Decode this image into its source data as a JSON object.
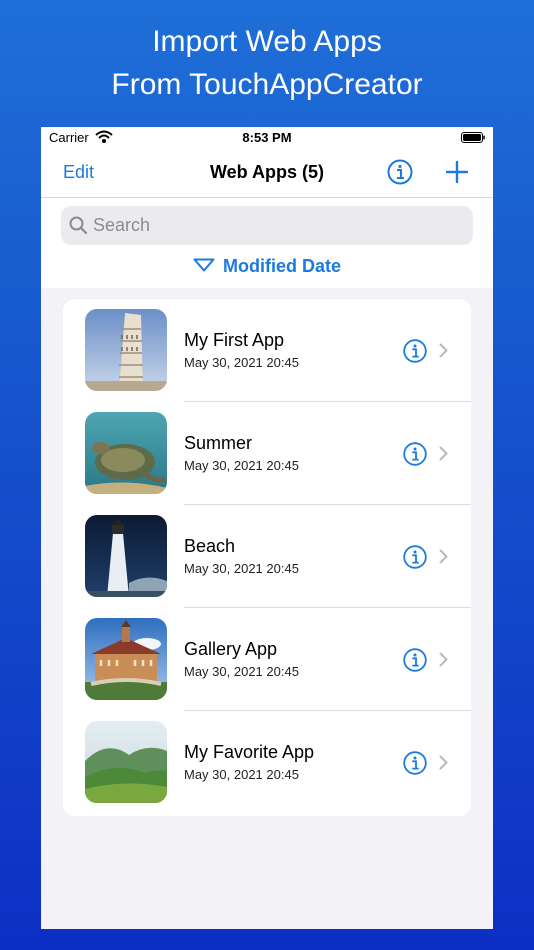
{
  "promo": {
    "line1": "Import Web Apps",
    "line2": "From TouchAppCreator"
  },
  "status_bar": {
    "carrier": "Carrier",
    "time": "8:53 PM",
    "icons": [
      "wifi-icon",
      "battery-icon"
    ]
  },
  "nav": {
    "edit_label": "Edit",
    "title": "Web Apps (5)",
    "icons": [
      "info-icon",
      "plus-icon"
    ]
  },
  "search": {
    "placeholder": "Search",
    "icon": "magnifier-icon"
  },
  "sort": {
    "label": "Modified Date",
    "icon": "triangle-down-icon"
  },
  "apps": [
    {
      "title": "My First App",
      "date": "May 30, 2021 20:45",
      "thumbnail": "leaning-tower-photo"
    },
    {
      "title": "Summer",
      "date": "May 30, 2021 20:45",
      "thumbnail": "sea-turtle-photo"
    },
    {
      "title": "Beach",
      "date": "May 30, 2021 20:45",
      "thumbnail": "lighthouse-photo"
    },
    {
      "title": "Gallery App",
      "date": "May 30, 2021 20:45",
      "thumbnail": "old-town-hall-photo"
    },
    {
      "title": "My Favorite App",
      "date": "May 30, 2021 20:45",
      "thumbnail": "green-hills-photo"
    }
  ],
  "colors": {
    "accent": "#1a7ae0",
    "background_top": "#1f6fd8",
    "background_bottom": "#0d2fc4"
  }
}
